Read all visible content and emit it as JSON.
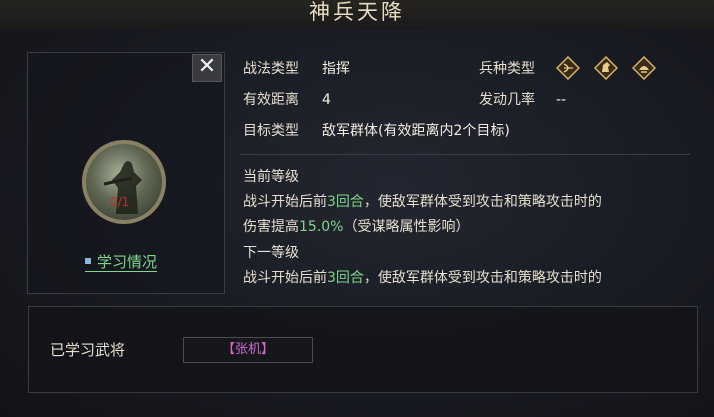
{
  "title": "神兵天降",
  "close_symbol": "✕",
  "portrait": {
    "count_text": "0/1"
  },
  "learn_link": "学习情况",
  "info": {
    "tactic_type_label": "战法类型",
    "tactic_type_value": "指挥",
    "range_label": "有效距离",
    "range_value": "4",
    "target_label": "目标类型",
    "target_value": "敌军群体(有效距离内2个目标)",
    "troop_type_label": "兵种类型",
    "trigger_rate_label": "发动几率",
    "trigger_rate_value": "--",
    "troop_icons": [
      "archer-troop-icon",
      "cavalry-troop-icon",
      "infantry-troop-icon"
    ]
  },
  "current_level": {
    "heading": "当前等级",
    "line1_pre": "战斗开始后前",
    "line1_num": "3回合",
    "line1_post": "，使敌军群体受到攻击和策略攻击时的",
    "line2_pre": "伤害提高",
    "line2_num": "15.0%",
    "line2_post": "（受谋略属性影响）"
  },
  "next_level": {
    "heading": "下一等级",
    "line1_pre": "战斗开始后前",
    "line1_num": "3回合",
    "line1_post": "，使敌军群体受到攻击和策略攻击时的"
  },
  "learned": {
    "label": "已学习武将",
    "general": "【张机】"
  },
  "colors": {
    "highlight": "#7fd68a",
    "general": "#d36ad0",
    "count": "#c0302a"
  }
}
